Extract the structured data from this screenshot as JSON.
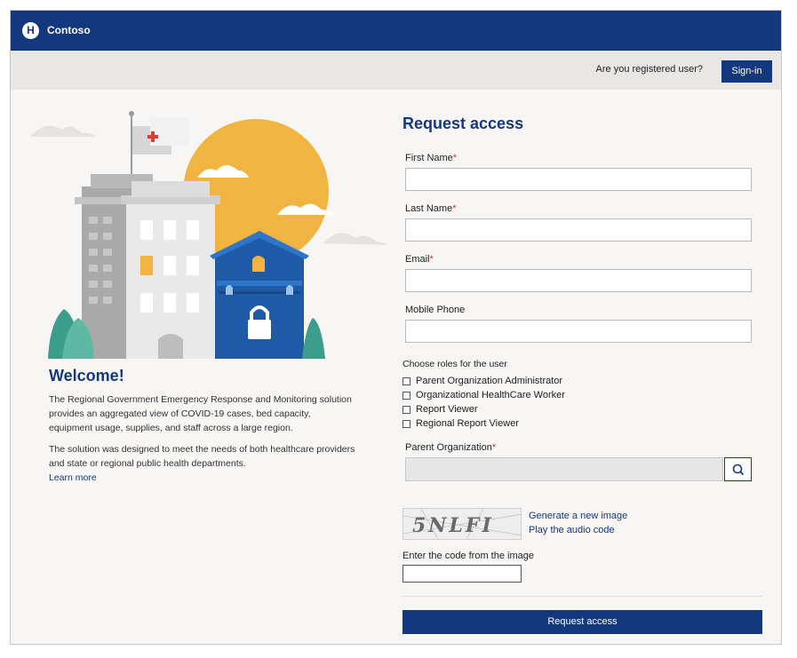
{
  "brand": {
    "logo_letter": "H",
    "name": "Contoso"
  },
  "subbar": {
    "question": "Are you registered user?",
    "signin_label": "Sign-in"
  },
  "welcome": {
    "title": "Welcome!",
    "paragraph1": "The Regional Government Emergency Response and Monitoring solution provides an aggregated view of COVID-19 cases, bed capacity, equipment usage, supplies, and staff across a large region.",
    "paragraph2": "The solution was designed to meet the needs of both healthcare providers and state or regional public health departments.",
    "learn_more": "Learn more"
  },
  "form": {
    "title": "Request access",
    "required_mark": "*",
    "first_name": {
      "label": "First Name",
      "value": ""
    },
    "last_name": {
      "label": "Last Name",
      "value": ""
    },
    "email": {
      "label": "Email",
      "value": ""
    },
    "mobile_phone": {
      "label": "Mobile Phone",
      "value": ""
    },
    "roles_label": "Choose roles for the user",
    "roles": [
      {
        "label": "Parent Organization Administrator",
        "checked": false
      },
      {
        "label": "Organizational HealthCare Worker",
        "checked": false
      },
      {
        "label": "Report Viewer",
        "checked": false
      },
      {
        "label": "Regional Report Viewer",
        "checked": false
      }
    ],
    "parent_org": {
      "label": "Parent Organization",
      "value": ""
    },
    "captcha": {
      "code": "5NLFI",
      "generate_link": "Generate a new image",
      "audio_link": "Play the audio code",
      "input_label": "Enter the code from the image",
      "value": ""
    },
    "submit_label": "Request access"
  },
  "colors": {
    "brand_blue": "#13387e",
    "required_red": "#c0392b",
    "sun": "#f2b441",
    "lock_building": "#1f5aa6"
  }
}
